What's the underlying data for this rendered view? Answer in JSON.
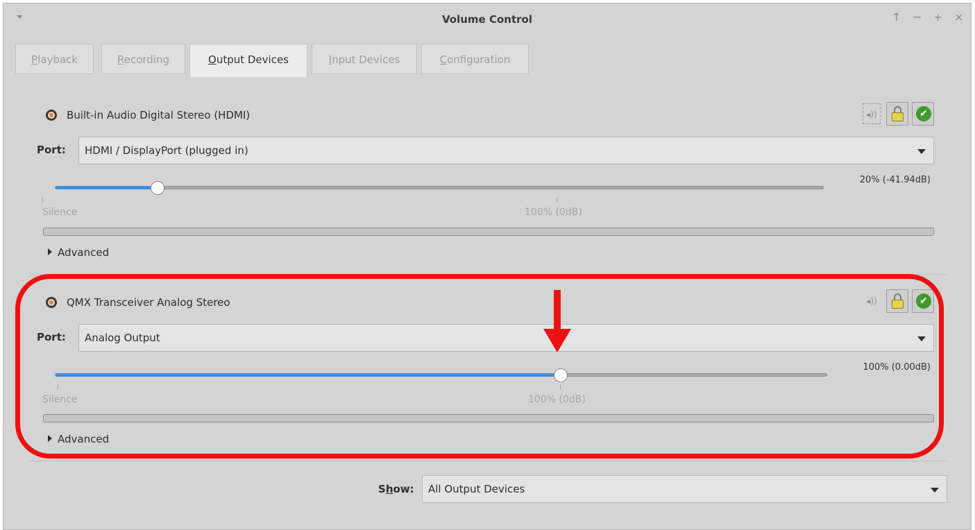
{
  "window": {
    "title": "Volume Control",
    "controls": {
      "up": "↑",
      "minimize": "−",
      "maximize": "+",
      "close": "×"
    }
  },
  "tabs": [
    {
      "label": "Playback",
      "mnemonic": "P",
      "rest": "layback",
      "active": false
    },
    {
      "label": "Recording",
      "mnemonic": "R",
      "rest": "ecording",
      "active": false
    },
    {
      "label": "Output Devices",
      "mnemonic": "O",
      "rest": "utput Devices",
      "active": true
    },
    {
      "label": "Input Devices",
      "mnemonic": "I",
      "rest": "nput Devices",
      "active": false
    },
    {
      "label": "Configuration",
      "mnemonic": "C",
      "rest": "onfiguration",
      "active": false
    }
  ],
  "devices": [
    {
      "name": "Built-in Audio Digital Stereo (HDMI)",
      "port_label": "Port:",
      "port_value": "HDMI / DisplayPort (plugged in)",
      "volume_text": "20% (-41.94dB)",
      "volume_fraction": 0.2,
      "tick_silence": "Silence",
      "tick_100": "100% (0dB)",
      "advanced_label": "Advanced",
      "locked": true,
      "is_default": true
    },
    {
      "name": "QMX Transceiver Analog Stereo",
      "port_label": "Port:",
      "port_value": "Analog Output",
      "volume_text": "100% (0.00dB)",
      "volume_fraction": 1.0,
      "tick_silence": "Silence",
      "tick_100": "100% (0dB)",
      "advanced_label": "Advanced",
      "locked": true,
      "is_default": true
    }
  ],
  "footer": {
    "show_label_mnemonic": "h",
    "show_label_prefix": "S",
    "show_label_suffix": "ow:",
    "show_value": "All Output Devices"
  },
  "icons": {
    "speaker": "speaker-icon",
    "mute": "volume-mute-icon",
    "lock": "lock-icon",
    "default": "checkmark-icon",
    "dropdown": "chevron-down-icon"
  },
  "annotation_color": "#ee1111",
  "accent_color": "#3d8ee0"
}
